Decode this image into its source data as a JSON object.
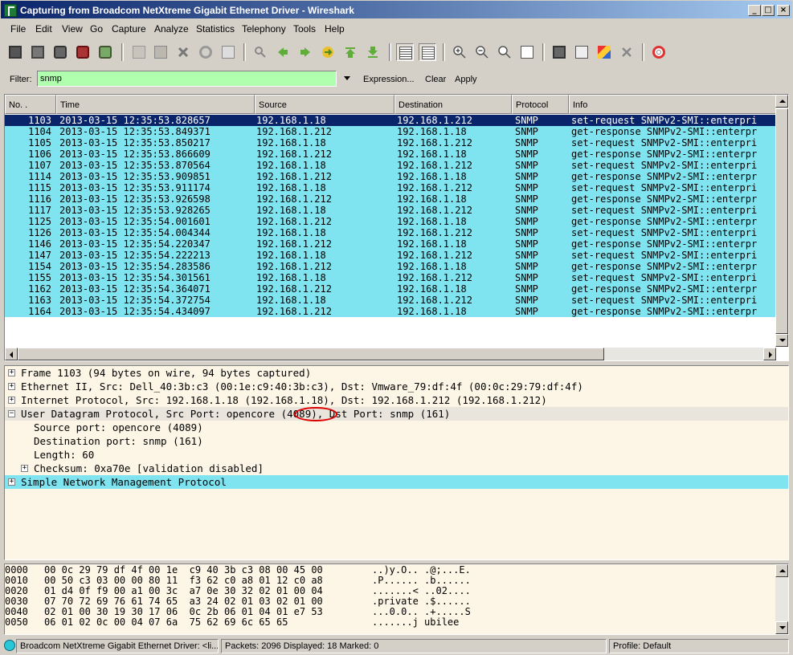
{
  "window": {
    "title": "Capturing from Broadcom NetXtreme Gigabit Ethernet Driver - Wireshark",
    "controls": {
      "minimize": "_",
      "maximize": "□",
      "close": "×"
    }
  },
  "menu": [
    "File",
    "Edit",
    "View",
    "Go",
    "Capture",
    "Analyze",
    "Statistics",
    "Telephony",
    "Tools",
    "Help"
  ],
  "toolbar": {
    "icons": [
      "interfaces-icon",
      "options-icon",
      "start-icon",
      "stop-icon",
      "restart-icon",
      "open-icon",
      "save-icon",
      "close-file-icon",
      "reload-icon",
      "print-icon",
      "find-icon",
      "back-icon",
      "forward-icon",
      "goto-icon",
      "first-packet-icon",
      "last-packet-icon",
      "colorize-icon",
      "autoscroll-icon",
      "zoom-in-icon",
      "zoom-out-icon",
      "normal-size-icon",
      "resize-columns-icon",
      "capture-filters-icon",
      "display-filters-icon",
      "coloring-rules-icon",
      "preferences-icon",
      "help-icon"
    ]
  },
  "filter": {
    "label": "Filter:",
    "value": "snmp",
    "expression": "Expression...",
    "clear": "Clear",
    "apply": "Apply",
    "valid_color": "#afffaf"
  },
  "packet_list": {
    "columns": [
      "No. .",
      "Time",
      "Source",
      "Destination",
      "Protocol",
      "Info"
    ],
    "row_color": "#7fe4f0",
    "selected_color": "#0a246a",
    "rows": [
      {
        "no": "1103",
        "time": "2013-03-15 12:35:53.828657",
        "src": "192.168.1.18",
        "dst": "192.168.1.212",
        "proto": "SNMP",
        "info": "set-request SNMPv2-SMI::enterpri"
      },
      {
        "no": "1104",
        "time": "2013-03-15 12:35:53.849371",
        "src": "192.168.1.212",
        "dst": "192.168.1.18",
        "proto": "SNMP",
        "info": "get-response SNMPv2-SMI::enterpr"
      },
      {
        "no": "1105",
        "time": "2013-03-15 12:35:53.850217",
        "src": "192.168.1.18",
        "dst": "192.168.1.212",
        "proto": "SNMP",
        "info": "set-request SNMPv2-SMI::enterpri"
      },
      {
        "no": "1106",
        "time": "2013-03-15 12:35:53.866609",
        "src": "192.168.1.212",
        "dst": "192.168.1.18",
        "proto": "SNMP",
        "info": "get-response SNMPv2-SMI::enterpr"
      },
      {
        "no": "1107",
        "time": "2013-03-15 12:35:53.870564",
        "src": "192.168.1.18",
        "dst": "192.168.1.212",
        "proto": "SNMP",
        "info": "set-request SNMPv2-SMI::enterpri"
      },
      {
        "no": "1114",
        "time": "2013-03-15 12:35:53.909851",
        "src": "192.168.1.212",
        "dst": "192.168.1.18",
        "proto": "SNMP",
        "info": "get-response SNMPv2-SMI::enterpr"
      },
      {
        "no": "1115",
        "time": "2013-03-15 12:35:53.911174",
        "src": "192.168.1.18",
        "dst": "192.168.1.212",
        "proto": "SNMP",
        "info": "set-request SNMPv2-SMI::enterpri"
      },
      {
        "no": "1116",
        "time": "2013-03-15 12:35:53.926598",
        "src": "192.168.1.212",
        "dst": "192.168.1.18",
        "proto": "SNMP",
        "info": "get-response SNMPv2-SMI::enterpr"
      },
      {
        "no": "1117",
        "time": "2013-03-15 12:35:53.928265",
        "src": "192.168.1.18",
        "dst": "192.168.1.212",
        "proto": "SNMP",
        "info": "set-request SNMPv2-SMI::enterpri"
      },
      {
        "no": "1125",
        "time": "2013-03-15 12:35:54.001601",
        "src": "192.168.1.212",
        "dst": "192.168.1.18",
        "proto": "SNMP",
        "info": "get-response SNMPv2-SMI::enterpr"
      },
      {
        "no": "1126",
        "time": "2013-03-15 12:35:54.004344",
        "src": "192.168.1.18",
        "dst": "192.168.1.212",
        "proto": "SNMP",
        "info": "set-request SNMPv2-SMI::enterpri"
      },
      {
        "no": "1146",
        "time": "2013-03-15 12:35:54.220347",
        "src": "192.168.1.212",
        "dst": "192.168.1.18",
        "proto": "SNMP",
        "info": "get-response SNMPv2-SMI::enterpr"
      },
      {
        "no": "1147",
        "time": "2013-03-15 12:35:54.222213",
        "src": "192.168.1.18",
        "dst": "192.168.1.212",
        "proto": "SNMP",
        "info": "set-request SNMPv2-SMI::enterpri"
      },
      {
        "no": "1154",
        "time": "2013-03-15 12:35:54.283586",
        "src": "192.168.1.212",
        "dst": "192.168.1.18",
        "proto": "SNMP",
        "info": "get-response SNMPv2-SMI::enterpr"
      },
      {
        "no": "1155",
        "time": "2013-03-15 12:35:54.301561",
        "src": "192.168.1.18",
        "dst": "192.168.1.212",
        "proto": "SNMP",
        "info": "set-request SNMPv2-SMI::enterpri"
      },
      {
        "no": "1162",
        "time": "2013-03-15 12:35:54.364071",
        "src": "192.168.1.212",
        "dst": "192.168.1.18",
        "proto": "SNMP",
        "info": "get-response SNMPv2-SMI::enterpr"
      },
      {
        "no": "1163",
        "time": "2013-03-15 12:35:54.372754",
        "src": "192.168.1.18",
        "dst": "192.168.1.212",
        "proto": "SNMP",
        "info": "set-request SNMPv2-SMI::enterpri"
      },
      {
        "no": "1164",
        "time": "2013-03-15 12:35:54.434097",
        "src": "192.168.1.212",
        "dst": "192.168.1.18",
        "proto": "SNMP",
        "info": "get-response SNMPv2-SMI::enterpr"
      }
    ]
  },
  "details": {
    "background": "#fdf5e6",
    "highlight": "#7fe4f0",
    "frame": "Frame 1103 (94 bytes on wire, 94 bytes captured)",
    "ethernet": "Ethernet II, Src: Dell_40:3b:c3 (00:1e:c9:40:3b:c3), Dst: Vmware_79:df:4f (00:0c:29:79:df:4f)",
    "ip": "Internet Protocol, Src: 192.168.1.18 (192.168.1.18), Dst: 192.168.1.212 (192.168.1.212)",
    "udp": "User Datagram Protocol, Src Port: opencore (4089), Dst Port: snmp (161)",
    "udp_children": {
      "src_port": "Source port: opencore (4089)",
      "dst_port": "Destination port: snmp (161)",
      "length": "Length: 60",
      "checksum": "Checksum: 0xa70e [validation disabled]"
    },
    "snmp": "Simple Network Management Protocol",
    "annotation_color": "#dd0000"
  },
  "bytes": [
    {
      "offset": "0000",
      "hex": "00 0c 29 79 df 4f 00 1e  c9 40 3b c3 08 00 45 00",
      "ascii": "..)y.O.. .@;...E."
    },
    {
      "offset": "0010",
      "hex": "00 50 c3 03 00 00 80 11  f3 62 c0 a8 01 12 c0 a8",
      "ascii": ".P...... .b......"
    },
    {
      "offset": "0020",
      "hex": "01 d4 0f f9 00 a1 00 3c  a7 0e 30 32 02 01 00 04",
      "ascii": ".......< ..02...."
    },
    {
      "offset": "0030",
      "hex": "07 70 72 69 76 61 74 65  a3 24 02 01 03 02 01 00",
      "ascii": ".private .$......"
    },
    {
      "offset": "0040",
      "hex": "02 01 00 30 19 30 17 06  0c 2b 06 01 04 01 e7 53",
      "ascii": "...0.0.. .+.....S"
    },
    {
      "offset": "0050",
      "hex": "06 01 02 0c 00 04 07 6a  75 62 69 6c 65 65",
      "ascii": ".......j ubilee"
    }
  ],
  "status": {
    "interface": "Broadcom NetXtreme Gigabit Ethernet Driver: <li...",
    "packets": "Packets: 2096 Displayed: 18 Marked: 0",
    "profile": "Profile: Default"
  }
}
